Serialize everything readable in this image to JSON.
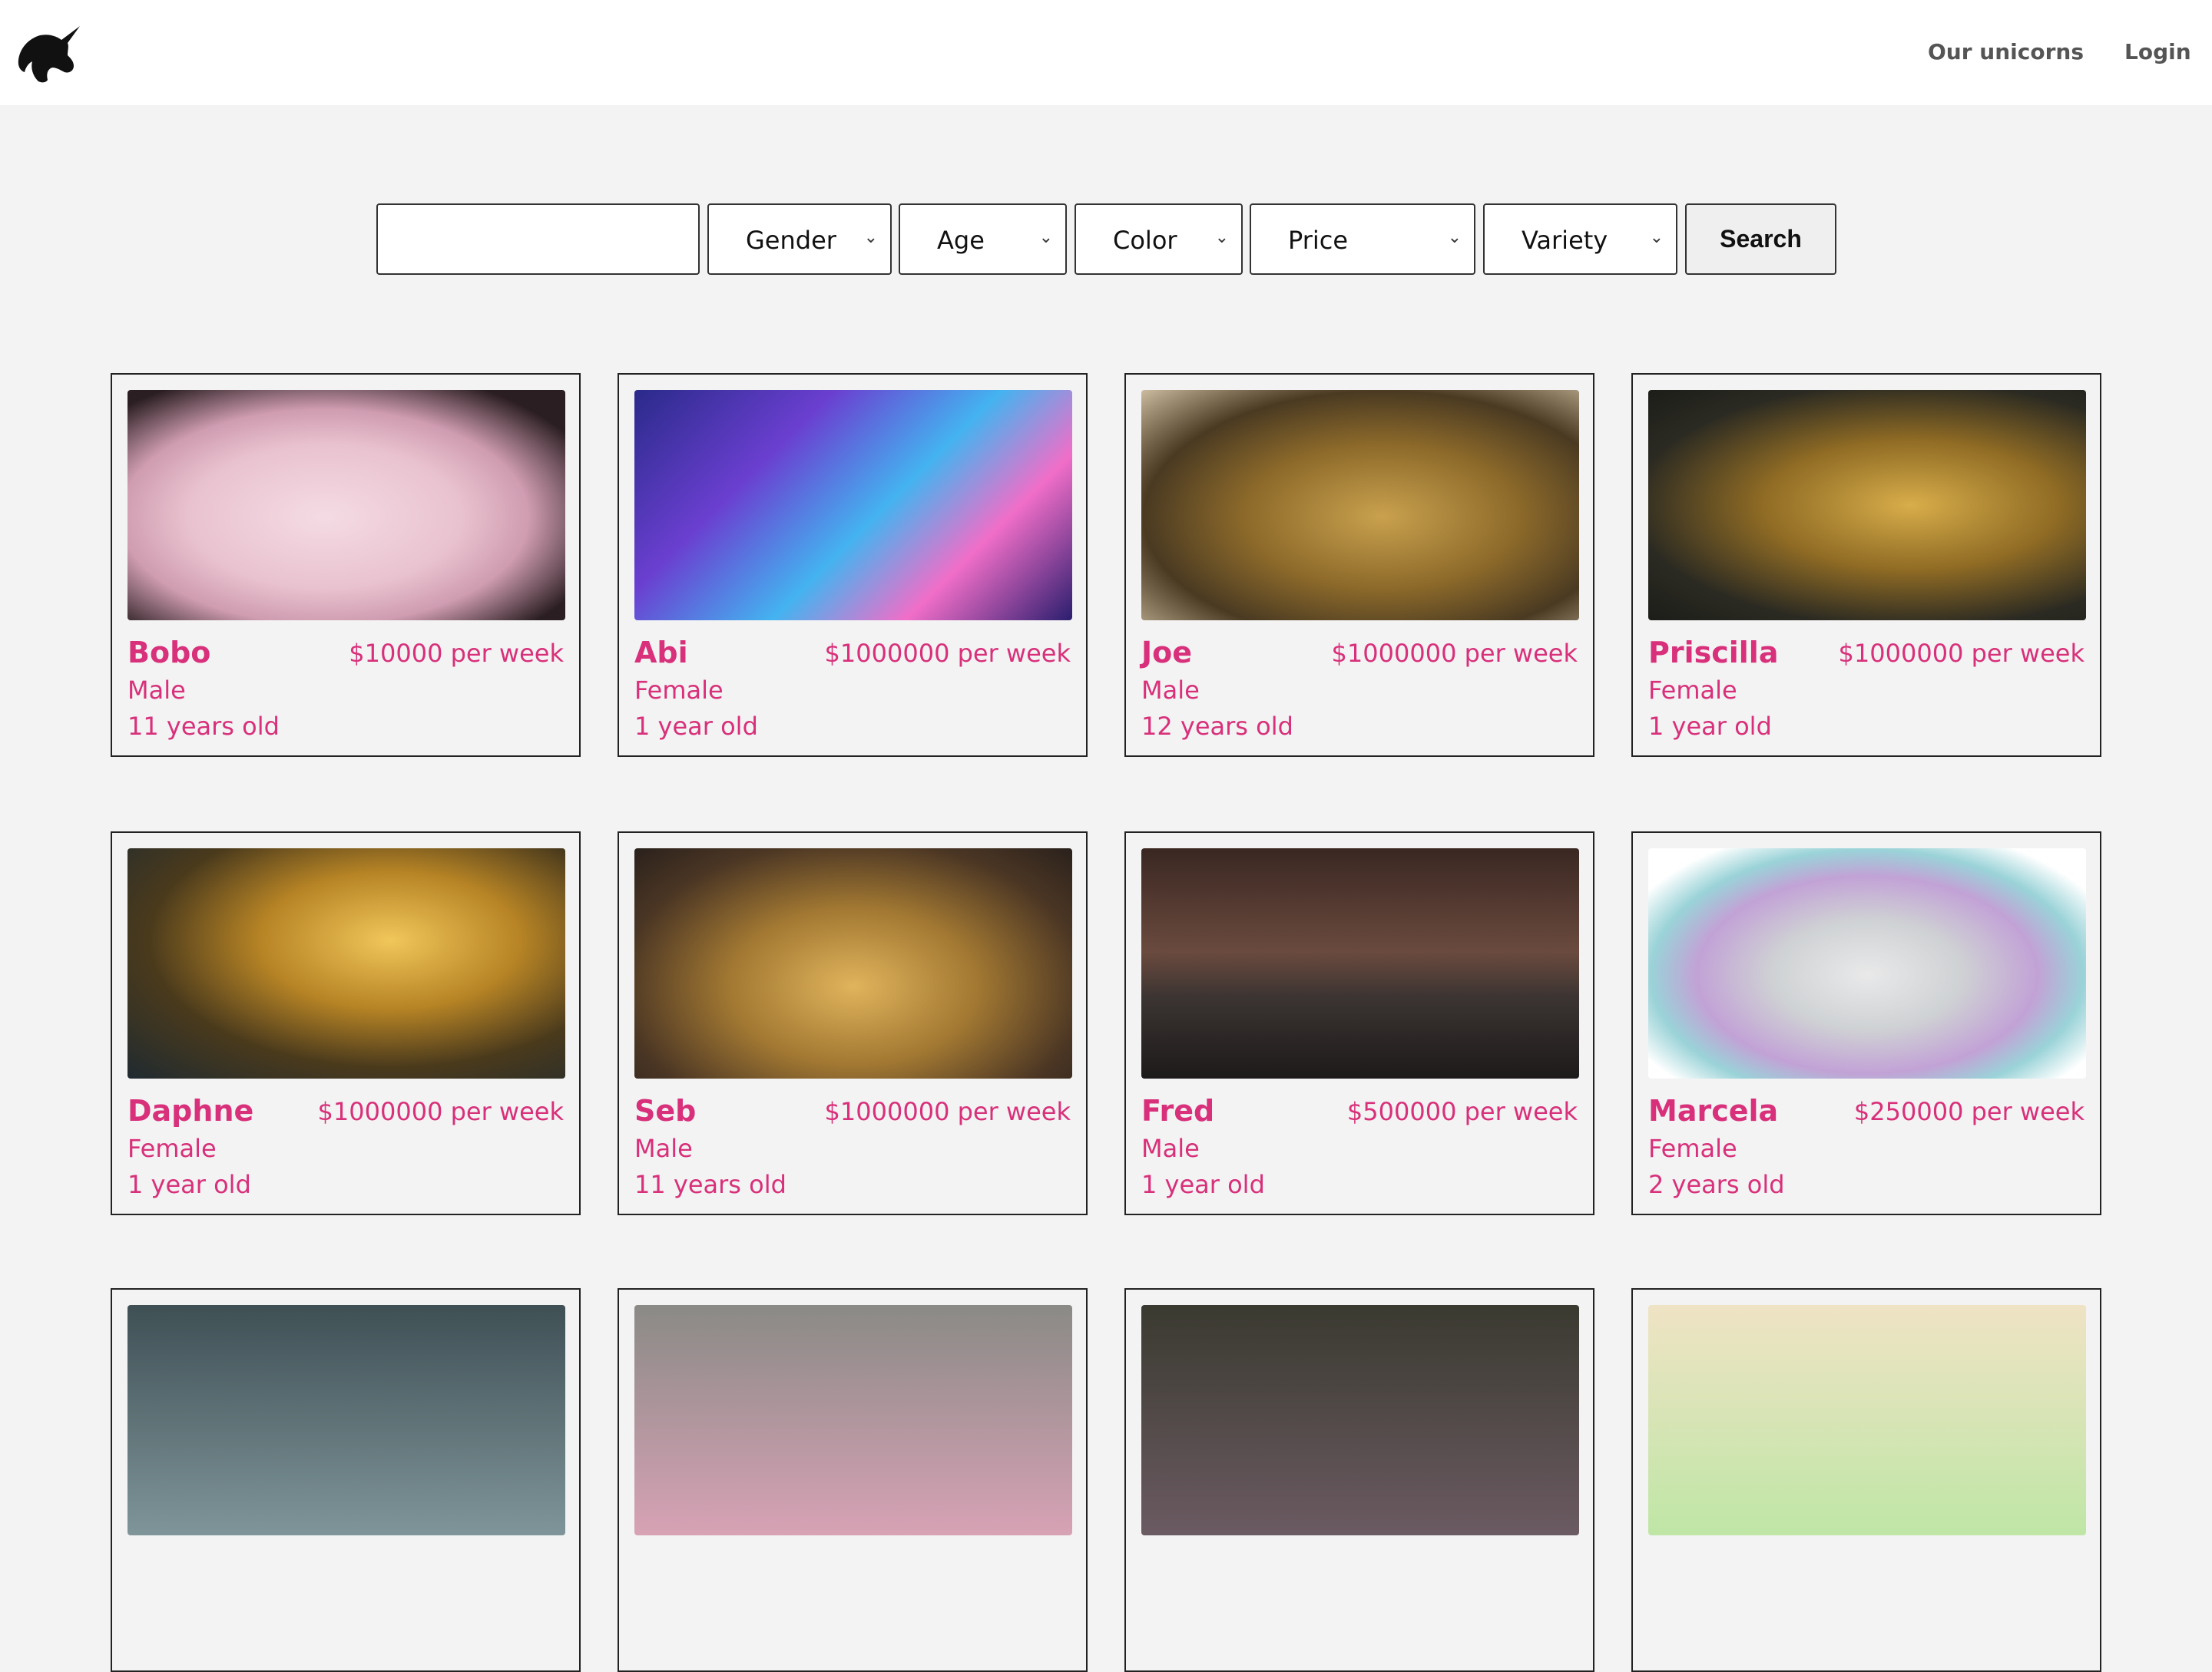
{
  "nav": {
    "logo": "unicorn-logo-icon",
    "links": [
      "Our unicorns",
      "Login"
    ]
  },
  "search": {
    "input_value": "",
    "input_placeholder": "",
    "selects": [
      "Gender",
      "Age",
      "Color",
      "Price",
      "Variety"
    ],
    "button_label": "Search"
  },
  "colors": {
    "accent": "#d8307a",
    "border": "#222222",
    "page_bg": "#f3f3f3"
  },
  "unicorns": [
    {
      "name": "Bobo",
      "price": "$10000 per week",
      "gender": "Male",
      "age": "11 years old"
    },
    {
      "name": "Abi",
      "price": "$1000000 per week",
      "gender": "Female",
      "age": "1 year old"
    },
    {
      "name": "Joe",
      "price": "$1000000 per week",
      "gender": "Male",
      "age": "12 years old"
    },
    {
      "name": "Priscilla",
      "price": "$1000000 per week",
      "gender": "Female",
      "age": "1 year old"
    },
    {
      "name": "Daphne",
      "price": "$1000000 per week",
      "gender": "Female",
      "age": "1 year old"
    },
    {
      "name": "Seb",
      "price": "$1000000 per week",
      "gender": "Male",
      "age": "11 years old"
    },
    {
      "name": "Fred",
      "price": "$500000 per week",
      "gender": "Male",
      "age": "1 year old"
    },
    {
      "name": "Marcela",
      "price": "$250000 per week",
      "gender": "Female",
      "age": "2 years old"
    }
  ]
}
